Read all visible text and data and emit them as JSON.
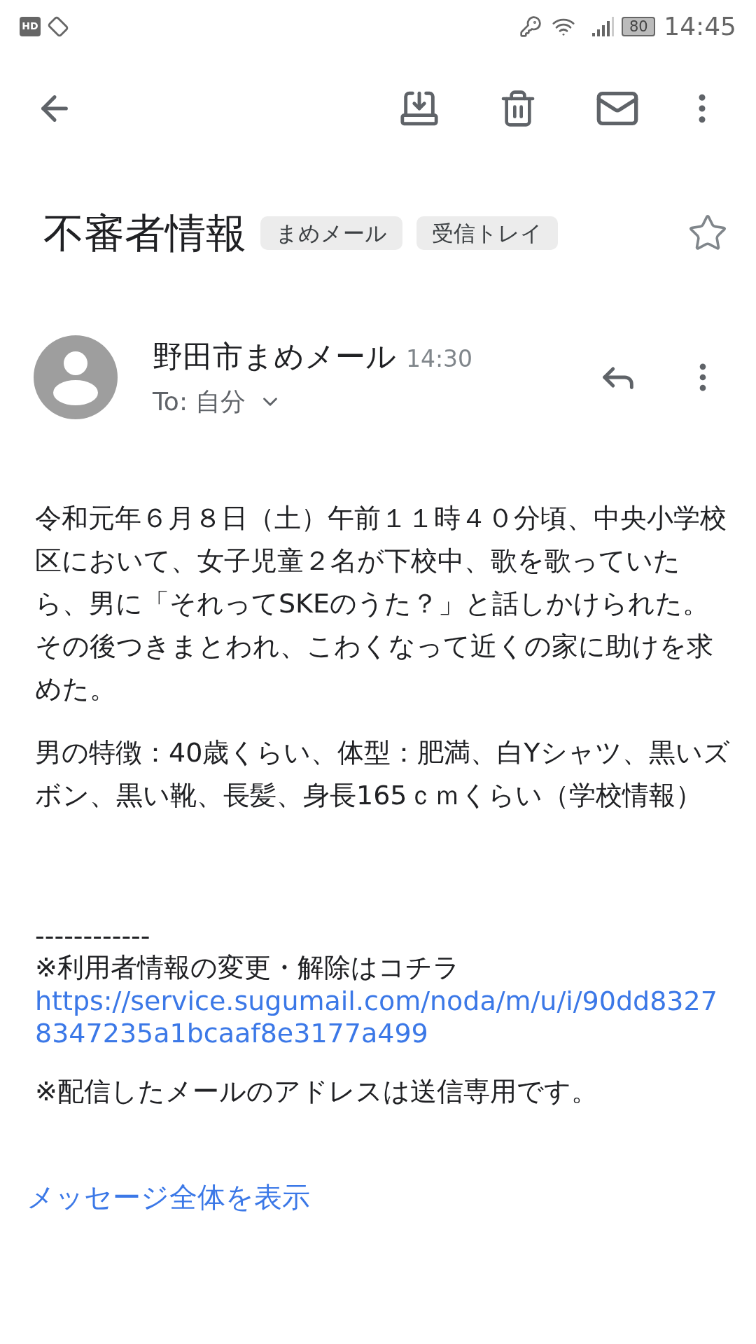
{
  "status_bar": {
    "hd_badge": "HD",
    "battery": "80",
    "time": "14:45"
  },
  "subject": "不審者情報",
  "labels": [
    "まめメール",
    "受信トレイ"
  ],
  "starred": false,
  "message": {
    "sender": "野田市まめメール",
    "time": "14:30",
    "recipient": "To: 自分"
  },
  "body": [
    {
      "kind": "paragraph",
      "text": "令和元年６月８日（土）午前１１時４０分頃、中央小学校区において、女子児童２名が下校中、歌を歌っていたら、男に「それってSKEのうた？」と話しかけられた。その後つきまとわれ、こわくなって近くの家に助けを求めた。"
    },
    {
      "kind": "paragraph",
      "text": "男の特徴：40歳くらい、体型：肥満、白Yシャツ、黒いズボン、黒い靴、長髪、身長165ｃｍくらい（学校情報）"
    },
    {
      "kind": "separator",
      "text": "------------"
    },
    {
      "kind": "line",
      "text": "※利用者情報の変更・解除はコチラ"
    },
    {
      "kind": "link",
      "text": "https://service.sugumail.com/noda/m/u/i/90dd83278347235a1bcaaf8e3177a499"
    },
    {
      "kind": "paragraph",
      "text": "※配信したメールのアドレスは送信専用です。"
    }
  ],
  "show_full_message": "メッセージ全体を表示"
}
